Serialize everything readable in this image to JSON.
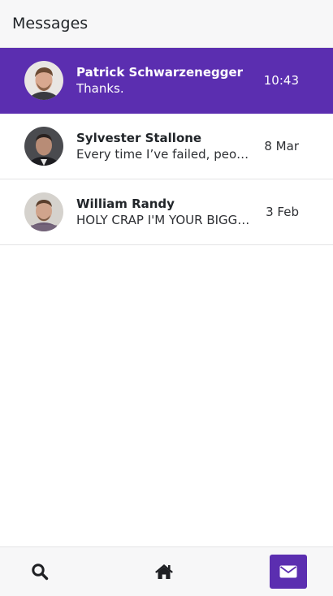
{
  "header": {
    "title": "Messages"
  },
  "messages": [
    {
      "name": "Patrick Schwarzenegger",
      "preview": "Thanks.",
      "time": "10:43",
      "active": true,
      "avatar": "avatar-patrick"
    },
    {
      "name": "Sylvester Stallone",
      "preview": "Every time I’ve failed, people have thought I was done",
      "time": "8 Mar",
      "active": false,
      "avatar": "avatar-sylvester"
    },
    {
      "name": "William Randy",
      "preview": "HOLY CRAP I'M YOUR BIGGEST FAN",
      "time": "3 Feb",
      "active": false,
      "avatar": "avatar-william"
    }
  ],
  "bottom_nav": [
    {
      "icon": "search-icon",
      "active": false
    },
    {
      "icon": "home-icon",
      "active": false
    },
    {
      "icon": "envelope-icon",
      "active": true
    }
  ],
  "colors": {
    "accent": "#5b2eb0",
    "header_bg": "#f7f7f8",
    "text": "#212529"
  }
}
